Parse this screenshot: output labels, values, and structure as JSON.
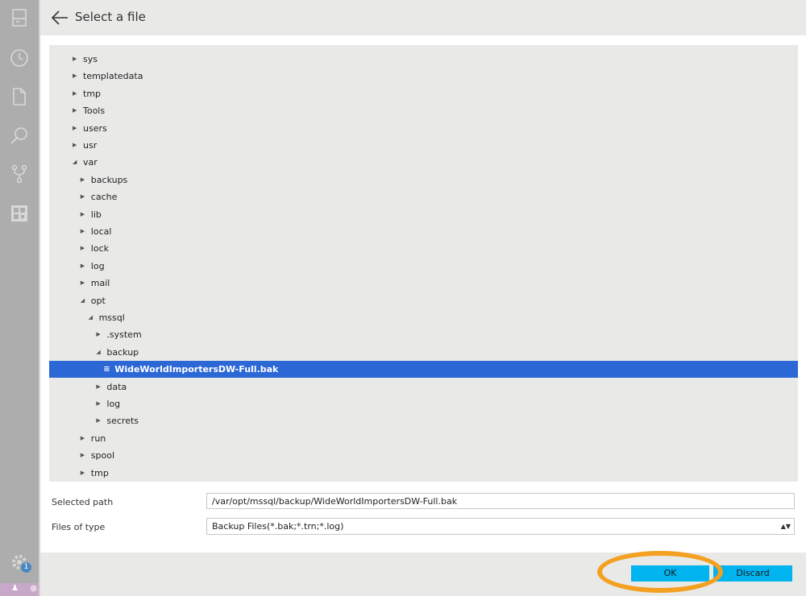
{
  "header": {
    "title": "Select a file"
  },
  "tree": [
    {
      "label": "sys",
      "depth": 0,
      "state": "collapsed"
    },
    {
      "label": "templatedata",
      "depth": 0,
      "state": "collapsed"
    },
    {
      "label": "tmp",
      "depth": 0,
      "state": "collapsed"
    },
    {
      "label": "Tools",
      "depth": 0,
      "state": "collapsed"
    },
    {
      "label": "users",
      "depth": 0,
      "state": "collapsed"
    },
    {
      "label": "usr",
      "depth": 0,
      "state": "collapsed"
    },
    {
      "label": "var",
      "depth": 0,
      "state": "expanded"
    },
    {
      "label": "backups",
      "depth": 1,
      "state": "collapsed"
    },
    {
      "label": "cache",
      "depth": 1,
      "state": "collapsed"
    },
    {
      "label": "lib",
      "depth": 1,
      "state": "collapsed"
    },
    {
      "label": "local",
      "depth": 1,
      "state": "collapsed"
    },
    {
      "label": "lock",
      "depth": 1,
      "state": "collapsed"
    },
    {
      "label": "log",
      "depth": 1,
      "state": "collapsed"
    },
    {
      "label": "mail",
      "depth": 1,
      "state": "collapsed"
    },
    {
      "label": "opt",
      "depth": 1,
      "state": "expanded"
    },
    {
      "label": "mssql",
      "depth": 2,
      "state": "expanded"
    },
    {
      "label": ".system",
      "depth": 3,
      "state": "collapsed"
    },
    {
      "label": "backup",
      "depth": 3,
      "state": "expanded"
    },
    {
      "label": "WideWorldImportersDW-Full.bak",
      "depth": 4,
      "state": "file",
      "selected": true
    },
    {
      "label": "data",
      "depth": 3,
      "state": "collapsed"
    },
    {
      "label": "log",
      "depth": 3,
      "state": "collapsed"
    },
    {
      "label": "secrets",
      "depth": 3,
      "state": "collapsed"
    },
    {
      "label": "run",
      "depth": 1,
      "state": "collapsed"
    },
    {
      "label": "spool",
      "depth": 1,
      "state": "collapsed"
    },
    {
      "label": "tmp",
      "depth": 1,
      "state": "collapsed"
    }
  ],
  "form": {
    "selected_path_label": "Selected path",
    "selected_path_value": "/var/opt/mssql/backup/WideWorldImportersDW-Full.bak",
    "files_of_type_label": "Files of type",
    "files_of_type_value": "Backup Files(*.bak;*.trn;*.log)"
  },
  "buttons": {
    "ok": "OK",
    "discard": "Discard"
  },
  "sidebar": {
    "icons": [
      "server-icon",
      "history-icon",
      "file-icon",
      "search-icon",
      "source-control-icon",
      "extensions-icon"
    ],
    "notification_count": "1"
  },
  "colors": {
    "selection": "#2c67d6",
    "button": "#00b4f0",
    "highlight_ring": "#f4a020",
    "sidebar": "#adadad"
  }
}
